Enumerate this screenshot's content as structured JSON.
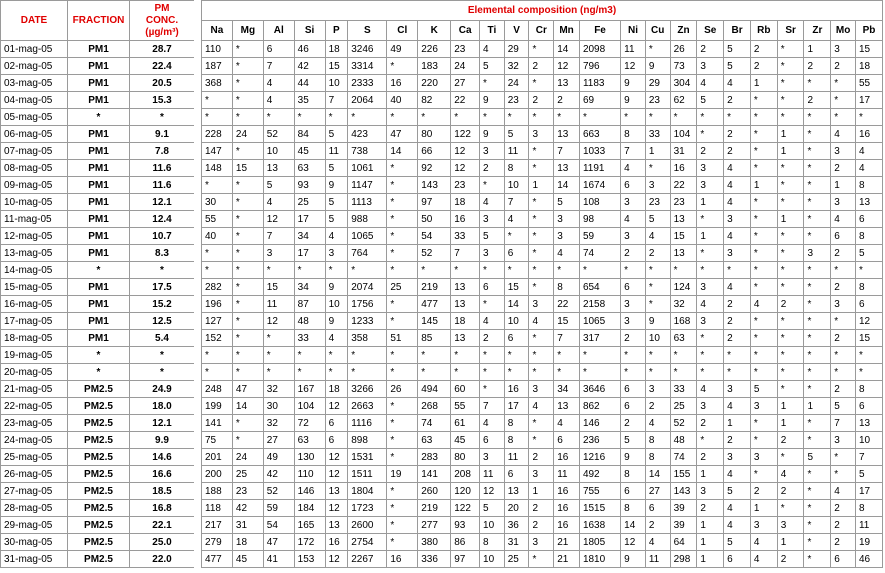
{
  "headers": {
    "date": "DATE",
    "fraction": "FRACTION",
    "pm_line1": "PM",
    "pm_line2": "CONC.",
    "pm_unit": "(µg/m³)",
    "elemental": "Elemental composition (ng/m3)"
  },
  "elements": [
    "Na",
    "Mg",
    "Al",
    "Si",
    "P",
    "S",
    "Cl",
    "K",
    "Ca",
    "Ti",
    "V",
    "Cr",
    "Mn",
    "Fe",
    "Ni",
    "Cu",
    "Zn",
    "Se",
    "Br",
    "Rb",
    "Sr",
    "Zr",
    "Mo",
    "Pb"
  ],
  "rows": [
    {
      "date": "01-mag-05",
      "fraction": "PM1",
      "conc": "28.7",
      "values": [
        "110",
        "*",
        "6",
        "46",
        "18",
        "3246",
        "49",
        "226",
        "23",
        "4",
        "29",
        "*",
        "14",
        "2098",
        "11",
        "*",
        "26",
        "2",
        "5",
        "2",
        "*",
        "1",
        "3",
        "15"
      ]
    },
    {
      "date": "02-mag-05",
      "fraction": "PM1",
      "conc": "22.4",
      "values": [
        "187",
        "*",
        "7",
        "42",
        "15",
        "3314",
        "*",
        "183",
        "24",
        "5",
        "32",
        "2",
        "12",
        "796",
        "12",
        "9",
        "73",
        "3",
        "5",
        "2",
        "*",
        "2",
        "2",
        "18"
      ]
    },
    {
      "date": "03-mag-05",
      "fraction": "PM1",
      "conc": "20.5",
      "values": [
        "368",
        "*",
        "4",
        "44",
        "10",
        "2333",
        "16",
        "220",
        "27",
        "*",
        "24",
        "*",
        "13",
        "1183",
        "9",
        "29",
        "304",
        "4",
        "4",
        "1",
        "*",
        "*",
        "*",
        "55"
      ]
    },
    {
      "date": "04-mag-05",
      "fraction": "PM1",
      "conc": "15.3",
      "values": [
        "*",
        "*",
        "4",
        "35",
        "7",
        "2064",
        "40",
        "82",
        "22",
        "9",
        "23",
        "2",
        "2",
        "69",
        "9",
        "23",
        "62",
        "5",
        "2",
        "*",
        "*",
        "2",
        "*",
        "17"
      ]
    },
    {
      "date": "05-mag-05",
      "fraction": "*",
      "conc": "*",
      "values": [
        "*",
        "*",
        "*",
        "*",
        "*",
        "*",
        "*",
        "*",
        "*",
        "*",
        "*",
        "*",
        "*",
        "*",
        "*",
        "*",
        "*",
        "*",
        "*",
        "*",
        "*",
        "*",
        "*",
        "*"
      ]
    },
    {
      "date": "06-mag-05",
      "fraction": "PM1",
      "conc": "9.1",
      "values": [
        "228",
        "24",
        "52",
        "84",
        "5",
        "423",
        "47",
        "80",
        "122",
        "9",
        "5",
        "3",
        "13",
        "663",
        "8",
        "33",
        "104",
        "*",
        "2",
        "*",
        "1",
        "*",
        "4",
        "16"
      ]
    },
    {
      "date": "07-mag-05",
      "fraction": "PM1",
      "conc": "7.8",
      "values": [
        "147",
        "*",
        "10",
        "45",
        "11",
        "738",
        "14",
        "66",
        "12",
        "3",
        "11",
        "*",
        "7",
        "1033",
        "7",
        "1",
        "31",
        "2",
        "2",
        "*",
        "1",
        "*",
        "3",
        "4"
      ]
    },
    {
      "date": "08-mag-05",
      "fraction": "PM1",
      "conc": "11.6",
      "values": [
        "148",
        "15",
        "13",
        "63",
        "5",
        "1061",
        "*",
        "92",
        "12",
        "2",
        "8",
        "*",
        "13",
        "1191",
        "4",
        "*",
        "16",
        "3",
        "4",
        "*",
        "*",
        "*",
        "2",
        "4"
      ]
    },
    {
      "date": "09-mag-05",
      "fraction": "PM1",
      "conc": "11.6",
      "values": [
        "*",
        "*",
        "5",
        "93",
        "9",
        "1147",
        "*",
        "143",
        "23",
        "*",
        "10",
        "1",
        "14",
        "1674",
        "6",
        "3",
        "22",
        "3",
        "4",
        "1",
        "*",
        "*",
        "1",
        "8"
      ]
    },
    {
      "date": "10-mag-05",
      "fraction": "PM1",
      "conc": "12.1",
      "values": [
        "30",
        "*",
        "4",
        "25",
        "5",
        "1113",
        "*",
        "97",
        "18",
        "4",
        "7",
        "*",
        "5",
        "108",
        "3",
        "23",
        "23",
        "1",
        "4",
        "*",
        "*",
        "*",
        "3",
        "13"
      ]
    },
    {
      "date": "11-mag-05",
      "fraction": "PM1",
      "conc": "12.4",
      "values": [
        "55",
        "*",
        "12",
        "17",
        "5",
        "988",
        "*",
        "50",
        "16",
        "3",
        "4",
        "*",
        "3",
        "98",
        "4",
        "5",
        "13",
        "*",
        "3",
        "*",
        "1",
        "*",
        "4",
        "6"
      ]
    },
    {
      "date": "12-mag-05",
      "fraction": "PM1",
      "conc": "10.7",
      "values": [
        "40",
        "*",
        "7",
        "34",
        "4",
        "1065",
        "*",
        "54",
        "33",
        "5",
        "*",
        "*",
        "3",
        "59",
        "3",
        "4",
        "15",
        "1",
        "4",
        "*",
        "*",
        "*",
        "6",
        "8"
      ]
    },
    {
      "date": "13-mag-05",
      "fraction": "PM1",
      "conc": "8.3",
      "values": [
        "*",
        "*",
        "3",
        "17",
        "3",
        "764",
        "*",
        "52",
        "7",
        "3",
        "6",
        "*",
        "4",
        "74",
        "2",
        "2",
        "13",
        "*",
        "3",
        "*",
        "*",
        "3",
        "2",
        "5"
      ]
    },
    {
      "date": "14-mag-05",
      "fraction": "*",
      "conc": "*",
      "values": [
        "*",
        "*",
        "*",
        "*",
        "*",
        "*",
        "*",
        "*",
        "*",
        "*",
        "*",
        "*",
        "*",
        "*",
        "*",
        "*",
        "*",
        "*",
        "*",
        "*",
        "*",
        "*",
        "*",
        "*"
      ]
    },
    {
      "date": "15-mag-05",
      "fraction": "PM1",
      "conc": "17.5",
      "values": [
        "282",
        "*",
        "15",
        "34",
        "9",
        "2074",
        "25",
        "219",
        "13",
        "6",
        "15",
        "*",
        "8",
        "654",
        "6",
        "*",
        "124",
        "3",
        "4",
        "*",
        "*",
        "*",
        "2",
        "8"
      ]
    },
    {
      "date": "16-mag-05",
      "fraction": "PM1",
      "conc": "15.2",
      "values": [
        "196",
        "*",
        "11",
        "87",
        "10",
        "1756",
        "*",
        "477",
        "13",
        "*",
        "14",
        "3",
        "22",
        "2158",
        "3",
        "*",
        "32",
        "4",
        "2",
        "4",
        "2",
        "*",
        "3",
        "6"
      ]
    },
    {
      "date": "17-mag-05",
      "fraction": "PM1",
      "conc": "12.5",
      "values": [
        "127",
        "*",
        "12",
        "48",
        "9",
        "1233",
        "*",
        "145",
        "18",
        "4",
        "10",
        "4",
        "15",
        "1065",
        "3",
        "9",
        "168",
        "3",
        "2",
        "*",
        "*",
        "*",
        "*",
        "12"
      ]
    },
    {
      "date": "18-mag-05",
      "fraction": "PM1",
      "conc": "5.4",
      "values": [
        "152",
        "*",
        "*",
        "33",
        "4",
        "358",
        "51",
        "85",
        "13",
        "2",
        "6",
        "*",
        "7",
        "317",
        "2",
        "10",
        "63",
        "*",
        "2",
        "*",
        "*",
        "*",
        "2",
        "15"
      ]
    },
    {
      "date": "19-mag-05",
      "fraction": "*",
      "conc": "*",
      "values": [
        "*",
        "*",
        "*",
        "*",
        "*",
        "*",
        "*",
        "*",
        "*",
        "*",
        "*",
        "*",
        "*",
        "*",
        "*",
        "*",
        "*",
        "*",
        "*",
        "*",
        "*",
        "*",
        "*",
        "*"
      ]
    },
    {
      "date": "20-mag-05",
      "fraction": "*",
      "conc": "*",
      "values": [
        "*",
        "*",
        "*",
        "*",
        "*",
        "*",
        "*",
        "*",
        "*",
        "*",
        "*",
        "*",
        "*",
        "*",
        "*",
        "*",
        "*",
        "*",
        "*",
        "*",
        "*",
        "*",
        "*",
        "*"
      ]
    },
    {
      "date": "21-mag-05",
      "fraction": "PM2.5",
      "conc": "24.9",
      "values": [
        "248",
        "47",
        "32",
        "167",
        "18",
        "3266",
        "26",
        "494",
        "60",
        "*",
        "16",
        "3",
        "34",
        "3646",
        "6",
        "3",
        "33",
        "4",
        "3",
        "5",
        "*",
        "*",
        "2",
        "8"
      ]
    },
    {
      "date": "22-mag-05",
      "fraction": "PM2.5",
      "conc": "18.0",
      "values": [
        "199",
        "14",
        "30",
        "104",
        "12",
        "2663",
        "*",
        "268",
        "55",
        "7",
        "17",
        "4",
        "13",
        "862",
        "6",
        "2",
        "25",
        "3",
        "4",
        "3",
        "1",
        "1",
        "5",
        "6"
      ]
    },
    {
      "date": "23-mag-05",
      "fraction": "PM2.5",
      "conc": "12.1",
      "values": [
        "141",
        "*",
        "32",
        "72",
        "6",
        "1116",
        "*",
        "74",
        "61",
        "4",
        "8",
        "*",
        "4",
        "146",
        "2",
        "4",
        "52",
        "2",
        "1",
        "*",
        "1",
        "*",
        "7",
        "13"
      ]
    },
    {
      "date": "24-mag-05",
      "fraction": "PM2.5",
      "conc": "9.9",
      "values": [
        "75",
        "*",
        "27",
        "63",
        "6",
        "898",
        "*",
        "63",
        "45",
        "6",
        "8",
        "*",
        "6",
        "236",
        "5",
        "8",
        "48",
        "*",
        "2",
        "*",
        "2",
        "*",
        "3",
        "10"
      ]
    },
    {
      "date": "25-mag-05",
      "fraction": "PM2.5",
      "conc": "14.6",
      "values": [
        "201",
        "24",
        "49",
        "130",
        "12",
        "1531",
        "*",
        "283",
        "80",
        "3",
        "11",
        "2",
        "16",
        "1216",
        "9",
        "8",
        "74",
        "2",
        "3",
        "3",
        "*",
        "5",
        "*",
        "7"
      ]
    },
    {
      "date": "26-mag-05",
      "fraction": "PM2.5",
      "conc": "16.6",
      "values": [
        "200",
        "25",
        "42",
        "110",
        "12",
        "1511",
        "19",
        "141",
        "208",
        "11",
        "6",
        "3",
        "11",
        "492",
        "8",
        "14",
        "155",
        "1",
        "4",
        "*",
        "4",
        "*",
        "*",
        "5"
      ]
    },
    {
      "date": "27-mag-05",
      "fraction": "PM2.5",
      "conc": "18.5",
      "values": [
        "188",
        "23",
        "52",
        "146",
        "13",
        "1804",
        "*",
        "260",
        "120",
        "12",
        "13",
        "1",
        "16",
        "755",
        "6",
        "27",
        "143",
        "3",
        "5",
        "2",
        "2",
        "*",
        "4",
        "17"
      ]
    },
    {
      "date": "28-mag-05",
      "fraction": "PM2.5",
      "conc": "16.8",
      "values": [
        "118",
        "42",
        "59",
        "184",
        "12",
        "1723",
        "*",
        "219",
        "122",
        "5",
        "20",
        "2",
        "16",
        "1515",
        "8",
        "6",
        "39",
        "2",
        "4",
        "1",
        "*",
        "*",
        "2",
        "8"
      ]
    },
    {
      "date": "29-mag-05",
      "fraction": "PM2.5",
      "conc": "22.1",
      "values": [
        "217",
        "31",
        "54",
        "165",
        "13",
        "2600",
        "*",
        "277",
        "93",
        "10",
        "36",
        "2",
        "16",
        "1638",
        "14",
        "2",
        "39",
        "1",
        "4",
        "3",
        "3",
        "*",
        "2",
        "11"
      ]
    },
    {
      "date": "30-mag-05",
      "fraction": "PM2.5",
      "conc": "25.0",
      "values": [
        "279",
        "18",
        "47",
        "172",
        "16",
        "2754",
        "*",
        "380",
        "86",
        "8",
        "31",
        "3",
        "21",
        "1805",
        "12",
        "4",
        "64",
        "1",
        "5",
        "4",
        "1",
        "*",
        "2",
        "19"
      ]
    },
    {
      "date": "31-mag-05",
      "fraction": "PM2.5",
      "conc": "22.0",
      "values": [
        "477",
        "45",
        "41",
        "153",
        "12",
        "2267",
        "16",
        "336",
        "97",
        "10",
        "25",
        "*",
        "21",
        "1810",
        "9",
        "11",
        "298",
        "1",
        "6",
        "4",
        "2",
        "*",
        "6",
        "46"
      ]
    }
  ]
}
